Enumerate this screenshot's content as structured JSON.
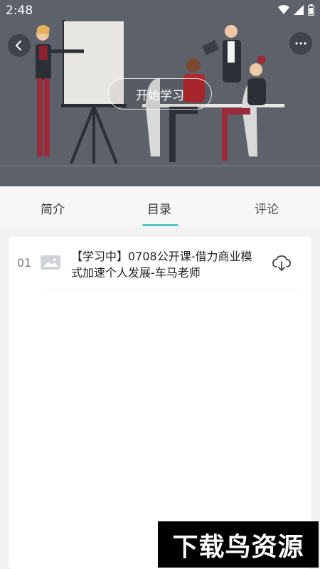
{
  "status_bar": {
    "time": "2:48"
  },
  "hero": {
    "start_button_label": "开始学习"
  },
  "tabs": [
    {
      "label": "简介"
    },
    {
      "label": "目录",
      "active": true
    },
    {
      "label": "评论"
    }
  ],
  "catalog": {
    "items": [
      {
        "index": "01",
        "title": "【学习中】0708公开课-借力商业模式加速个人发展-车马老师"
      }
    ]
  },
  "watermark": {
    "text": "下载鸟资源"
  },
  "colors": {
    "accent": "#4fc5c8",
    "hero_bg": "#5c616a"
  }
}
